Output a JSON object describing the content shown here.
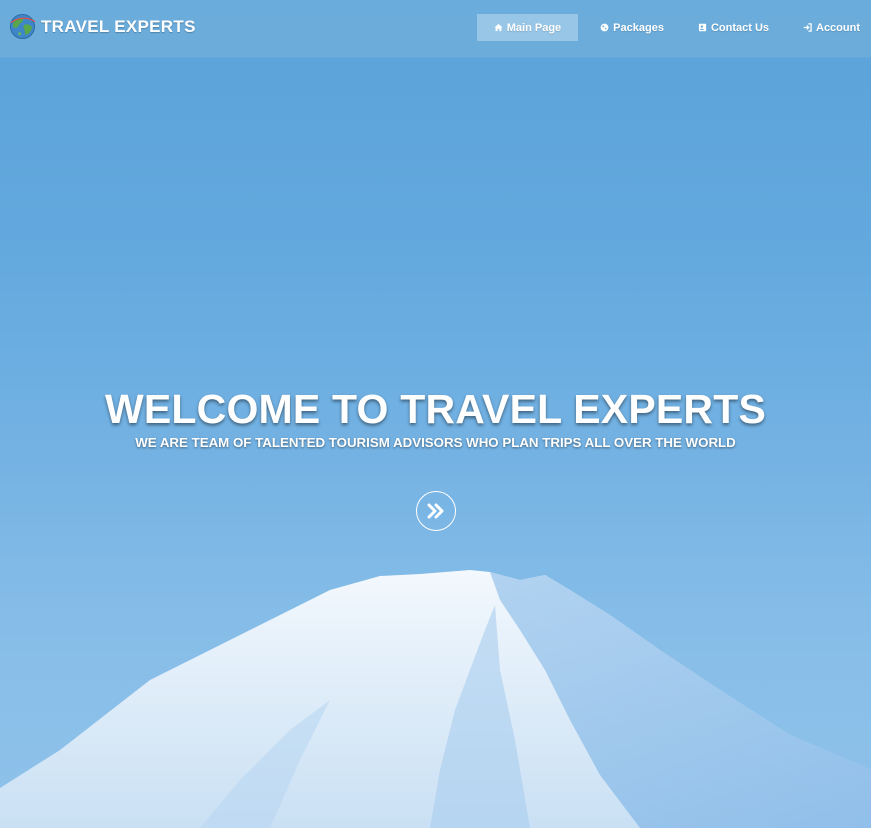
{
  "brand": {
    "name": "TRAVEL EXPERTS",
    "logo_icon": "globe-icon"
  },
  "nav": {
    "items": [
      {
        "label": "Main Page",
        "icon": "home-icon",
        "active": true
      },
      {
        "label": "Packages",
        "icon": "globe-small-icon",
        "active": false
      },
      {
        "label": "Contact Us",
        "icon": "contact-card-icon",
        "active": false
      },
      {
        "label": "Account",
        "icon": "login-icon",
        "active": false
      }
    ]
  },
  "hero": {
    "title": "WELCOME TO TRAVEL EXPERTS",
    "subtitle": "WE ARE TEAM OF TALENTED TOURISM ADVISORS WHO PLAN TRIPS ALL OVER THE WORLD",
    "scroll_icon": "double-chevron-right-icon"
  },
  "colors": {
    "sky_top": "#5aa2d9",
    "sky_bottom": "#8fc2ea",
    "snow": "#eef5fc",
    "text": "#ffffff"
  }
}
